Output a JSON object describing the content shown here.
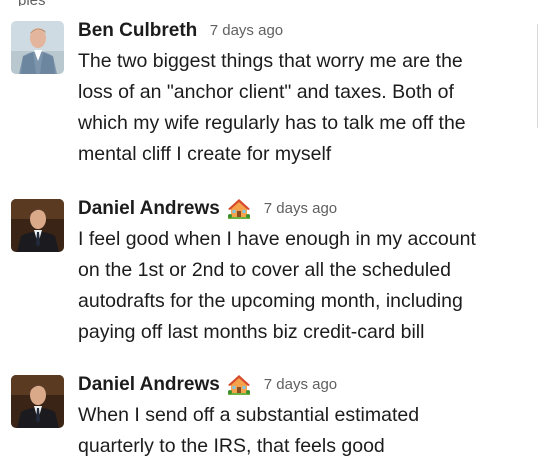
{
  "top_fragment": "ples",
  "messages": [
    {
      "author": "Ben Culbreth",
      "timestamp": "7 days ago",
      "badge_icon": "",
      "text": "The two biggest things that worry me are the\nloss of an \"anchor client\" and taxes. Both of\nwhich my wife regularly has to talk me off the\nmental cliff I create for myself"
    },
    {
      "author": "Daniel Andrews",
      "timestamp": "7 days ago",
      "badge_icon": "house-with-garden-emoji",
      "text": "I feel good when I have enough in my account\non the 1st or 2nd to cover all the scheduled\nautodrafts for the upcoming month, including\npaying off last months biz credit-card bill"
    },
    {
      "author": "Daniel Andrews",
      "timestamp": "7 days ago",
      "badge_icon": "house-with-garden-emoji",
      "text": "When I send off a substantial estimated\nquarterly to the IRS, that feels good"
    }
  ],
  "colors": {
    "text": "#1d1c1d",
    "muted": "#616061",
    "background": "#ffffff"
  }
}
